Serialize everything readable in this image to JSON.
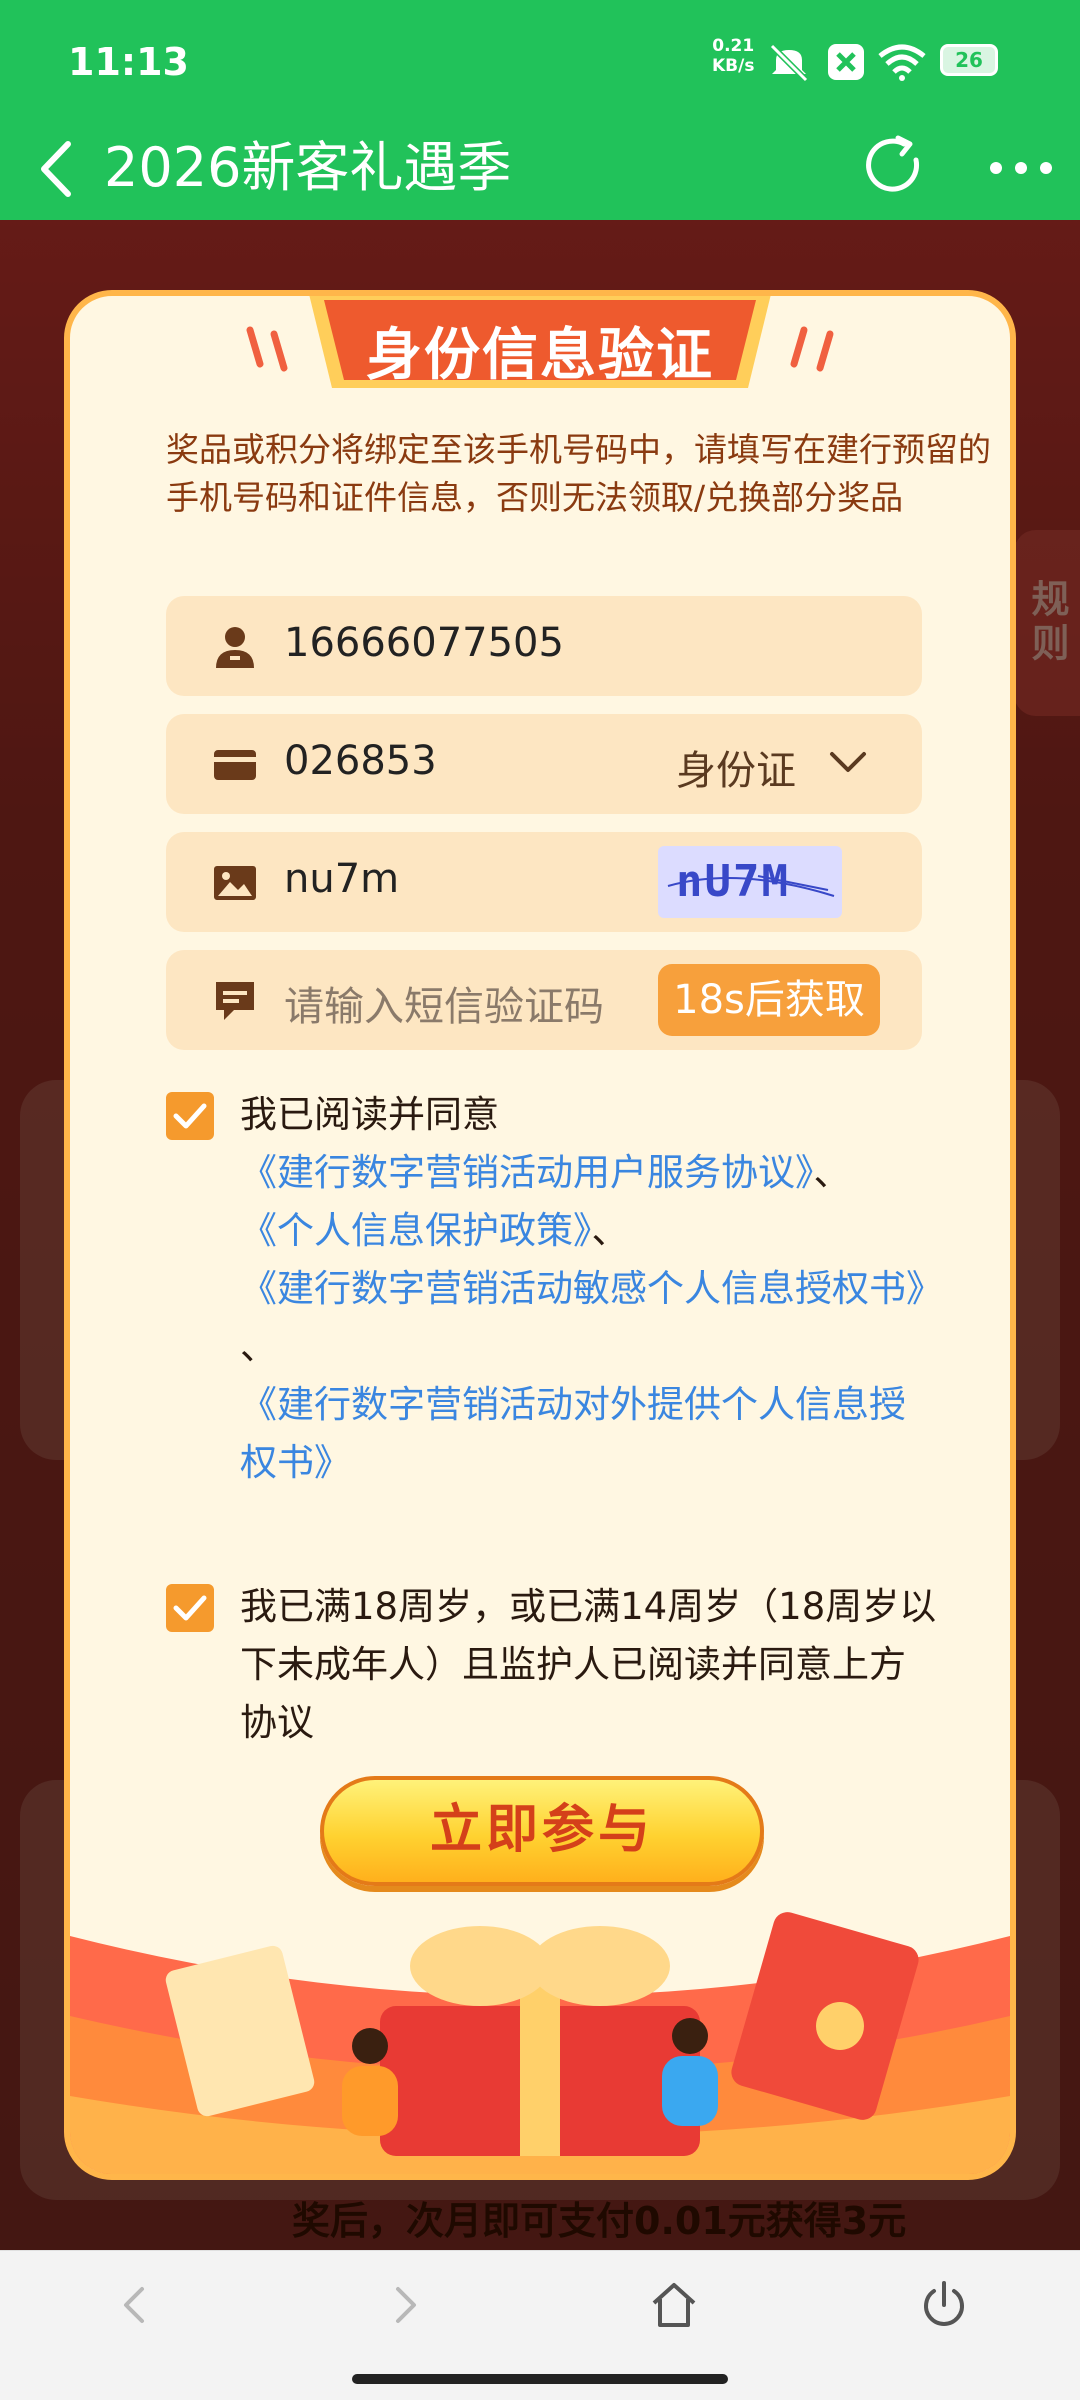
{
  "status_bar": {
    "time": "11:13",
    "net_speed_value": "0.21",
    "net_speed_unit": "KB/s",
    "battery": "26"
  },
  "title_bar": {
    "title": "2026新客礼遇季"
  },
  "background": {
    "rules_tab": "规则",
    "footer_text": "奖后，次月即可支付0.01元获得3元"
  },
  "modal": {
    "title": "身份信息验证",
    "notice": "奖品或积分将绑定至该手机号码中，请填写在建行预留的手机号码和证件信息，否则无法领取/兑换部分奖品",
    "phone": "16666077505",
    "id_number": "026853",
    "id_type": "身份证",
    "captcha_input": "nu7m",
    "captcha_image_text": "nU7M",
    "sms_placeholder": "请输入短信验证码",
    "sms_button": "18s后获取",
    "agreement": {
      "prefix": "我已阅读并同意",
      "link1": "《建行数字营销活动用户服务协议》",
      "sep1": "、",
      "link2": "《个人信息保护政策》",
      "sep2": "、",
      "link3": "《建行数字营销活动敏感个人信息授权书》",
      "sep3": "、",
      "link4": "《建行数字营销活动对外提供个人信息授权书》"
    },
    "age_statement": "我已满18周岁，或已满14周岁（18周岁以下未成年人）且监护人已阅读并同意上方协议",
    "submit": "立即参与"
  },
  "colors": {
    "header_green": "#21c25a",
    "accent_orange": "#f59a2d",
    "link_blue": "#3a86e0",
    "title_red": "#e8472a"
  }
}
